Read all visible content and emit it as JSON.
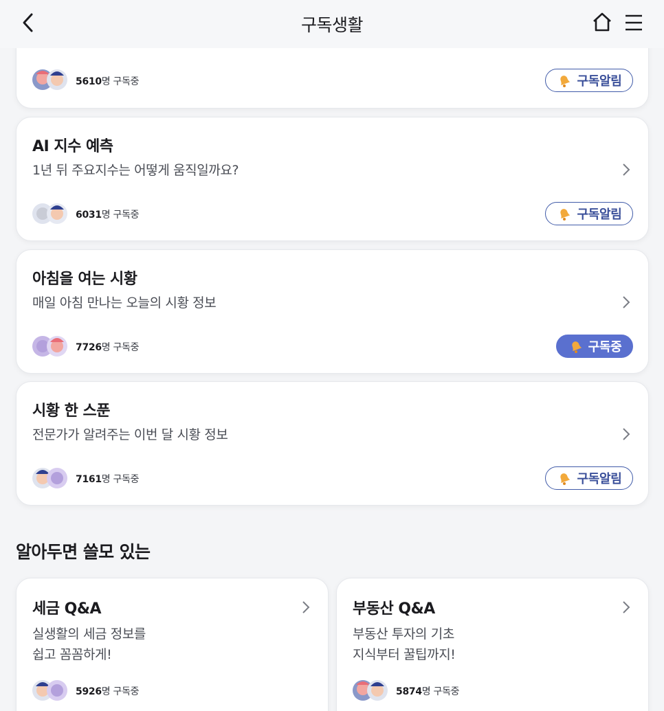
{
  "header": {
    "title": "구독생활"
  },
  "subscriptions": [
    {
      "title": "",
      "description": "",
      "count": "5610",
      "count_suffix": "명 구독중",
      "button": "구독알림",
      "subscribed": false
    },
    {
      "title": "AI 지수 예측",
      "description": "1년 뒤 주요지수는 어떻게 움직일까요?",
      "count": "6031",
      "count_suffix": "명 구독중",
      "button": "구독알림",
      "subscribed": false
    },
    {
      "title": "아침을 여는 시황",
      "description": "매일 아침 만나는 오늘의 시황 정보",
      "count": "7726",
      "count_suffix": "명 구독중",
      "button": "구독중",
      "subscribed": true
    },
    {
      "title": "시황 한 스푼",
      "description": "전문가가 알려주는 이번 달 시황 정보",
      "count": "7161",
      "count_suffix": "명 구독중",
      "button": "구독알림",
      "subscribed": false
    }
  ],
  "section": {
    "title": "알아두면 쓸모 있는",
    "cards": [
      {
        "title": "세금 Q&A",
        "line1": "실생활의 세금 정보를",
        "line2": "쉽고 꼼꼼하게!",
        "count": "5926",
        "count_suffix": "명 구독중"
      },
      {
        "title": "부동산 Q&A",
        "line1": "부동산 투자의 기초",
        "line2": "지식부터 꿀팁까지!",
        "count": "5874",
        "count_suffix": "명 구독중"
      }
    ]
  },
  "colors": {
    "accent": "#5a70cf",
    "outline": "#3f5aa8",
    "bell": "#f2a93b"
  },
  "icons": [
    "back-arrow-icon",
    "home-icon",
    "menu-icon",
    "bell-icon",
    "chevron-right-icon",
    "avatar-icon"
  ]
}
